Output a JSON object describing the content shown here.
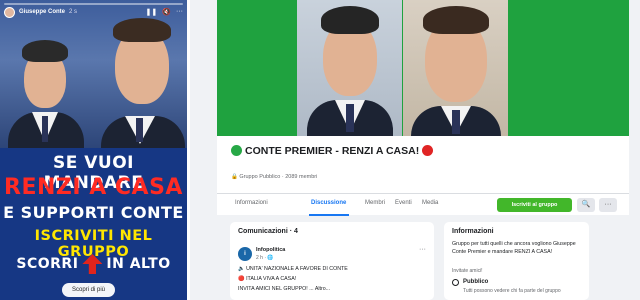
{
  "story": {
    "username": "Giuseppe Conte",
    "time": "2 s",
    "controls": {
      "pause": "❚❚",
      "mute": "🔇",
      "more": "···"
    },
    "text_lines": [
      {
        "text": "SE VUOI MANDARE",
        "tone": "white"
      },
      {
        "text": "RENZI A CASA",
        "tone": "red"
      },
      {
        "text": "E SUPPORTI CONTE",
        "tone": "white"
      },
      {
        "text": "ISCRIVITI NEL GRUPPO",
        "tone": "yellow"
      }
    ],
    "scroll_left": "SCORRI",
    "scroll_right": "IN ALTO",
    "cta": "Scopri di più"
  },
  "group": {
    "title": "CONTE PREMIER - RENZI A CASA!",
    "meta": "🔒 Gruppo Pubblico · 2089 membri",
    "tabs": [
      {
        "label": "Informazioni",
        "active": false
      },
      {
        "label": "Discussione",
        "active": true
      },
      {
        "label": "Membri",
        "active": false
      },
      {
        "label": "Eventi",
        "active": false
      },
      {
        "label": "Media",
        "active": false
      }
    ],
    "join_label": "Iscriviti al gruppo",
    "search_icon": "🔍",
    "more_icon": "···"
  },
  "feed": {
    "heading": "Comunicazioni · 4",
    "post": {
      "avatar_letter": "i",
      "author": "Infopolitica",
      "time": "2 h · 🌐",
      "more": "···",
      "lines": [
        "🔈 UNITA' NAZIONALE A FAVORE DI CONTE",
        "🔴 ITALIA VIVA A CASA!",
        "INVITA AMICI NEL GRUPPO! ... Altro..."
      ]
    }
  },
  "info": {
    "heading": "Informazioni",
    "description": "Gruppo per tutti quelli che ancora vogliono Giuseppe Conte Premier e mandare RENZI A CASA!",
    "invite": "Invitate amici!",
    "privacy_title": "Pubblico",
    "privacy_desc": "Tutti possono vedere chi fa parte del gruppo"
  },
  "colors": {
    "cover_green": "#1fa23f",
    "join_green": "#42b72a",
    "link_blue": "#1877f2",
    "story_blue": "#163784",
    "accent_red": "#ff2b23",
    "accent_yellow": "#ffe600"
  }
}
